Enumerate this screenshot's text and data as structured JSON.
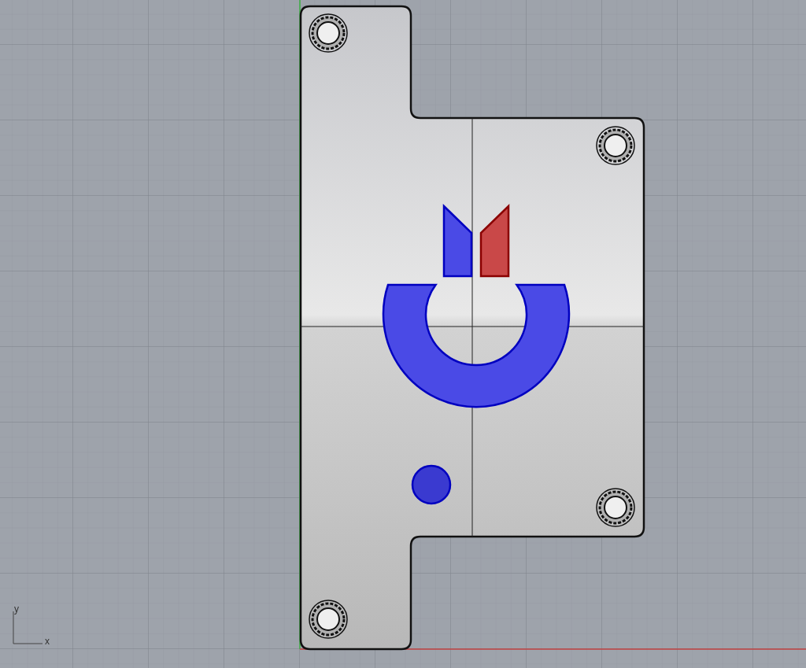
{
  "viewport": {
    "axis_labels": {
      "y": "y",
      "x": "x"
    },
    "features": [
      {
        "kind": "pocket",
        "color": "#4a4ae6"
      },
      {
        "kind": "pocket",
        "color": "#c94848"
      },
      {
        "kind": "ring",
        "color": "#4a4ae6"
      },
      {
        "kind": "circle",
        "color": "#3a3ad0"
      }
    ]
  }
}
